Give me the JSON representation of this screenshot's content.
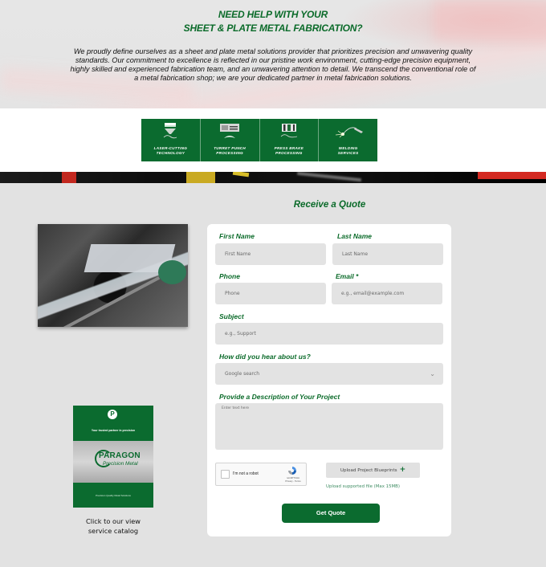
{
  "hero": {
    "title_line1": "NEED HELP WITH YOUR",
    "title_line2": "SHEET & PLATE METAL FABRICATION?",
    "description": "We proudly define ourselves as a sheet and plate metal solutions provider that prioritizes precision and unwavering quality standards. Our commitment to excellence is reflected in our pristine work environment, cutting-edge precision equipment, highly skilled and experienced fabrication team, and an unwavering attention to detail. We transcend the conventional role of a metal fabrication shop; we are your dedicated partner in metal fabrication solutions."
  },
  "services": [
    {
      "icon": "laser-cutting-icon",
      "line1": "LASER-CUTTING",
      "line2": "TECHNOLOGY"
    },
    {
      "icon": "turret-punch-icon",
      "line1": "TURRET PUNCH",
      "line2": "PROCESSING"
    },
    {
      "icon": "press-brake-icon",
      "line1": "PRESS BRAKE",
      "line2": "PROCESSING"
    },
    {
      "icon": "welding-icon",
      "line1": "WELDING",
      "line2": "SERVICES"
    }
  ],
  "quote": {
    "title": "Receive a Quote"
  },
  "catalog": {
    "logo_letter": "P",
    "tagline": "Your trusted partner in precision",
    "brand": "PARAGON",
    "brand_sub": "Precision Metal",
    "footer": "Precision Quality Metal Solutions",
    "caption_line1": "Click to our view",
    "caption_line2": "service catalog"
  },
  "form": {
    "first_name": {
      "label": "First Name",
      "placeholder": "First Name"
    },
    "last_name": {
      "label": "Last Name",
      "placeholder": "Last Name"
    },
    "phone": {
      "label": "Phone",
      "placeholder": "Phone"
    },
    "email": {
      "label": "Email *",
      "placeholder": "e.g., email@example.com"
    },
    "subject": {
      "label": "Subject",
      "placeholder": "e.g., Support"
    },
    "referral": {
      "label": "How did you hear about us?",
      "selected": "Google search"
    },
    "description": {
      "label": "Provide a Description of Your Project",
      "placeholder": "Enter text here"
    },
    "captcha": {
      "label": "I'm not a robot",
      "brand": "reCAPTCHA",
      "links": "Privacy - Terms"
    },
    "upload": {
      "label": "Upload Project Blueprints",
      "icon": "+",
      "note": "Upload supported file (Max 15MB)"
    },
    "submit": "Get Quote"
  },
  "colors": {
    "brand_green": "#0b6b2f",
    "field_bg": "#e3e3e3",
    "page_bg": "#e2e2e2"
  }
}
